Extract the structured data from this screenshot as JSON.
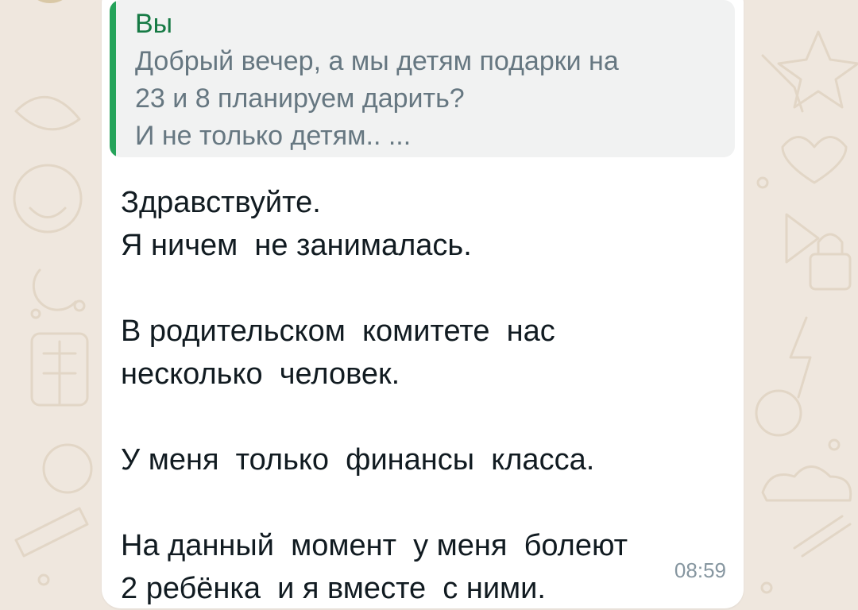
{
  "chat": {
    "reply": {
      "author": "Вы",
      "text": "Добрый вечер, а мы детям подарки на\n23 и 8 планируем дарить?\nИ не только детям.. ..."
    },
    "message": {
      "text": "Здравствуйте.\nЯ ничем  не занималась.\n\nВ родительском  комитете  нас\nнесколько  человек.\n\nУ меня  только  финансы  класса.\n\nНа данный  момент  у меня  болеют\n2 ребёнка  и я вместе  с ними.",
      "time": "08:59"
    }
  },
  "colors": {
    "wallpaper": "#efe7de",
    "bubble": "#ffffff",
    "quote_bar": "#25a35a",
    "quote_author": "#167a45"
  }
}
